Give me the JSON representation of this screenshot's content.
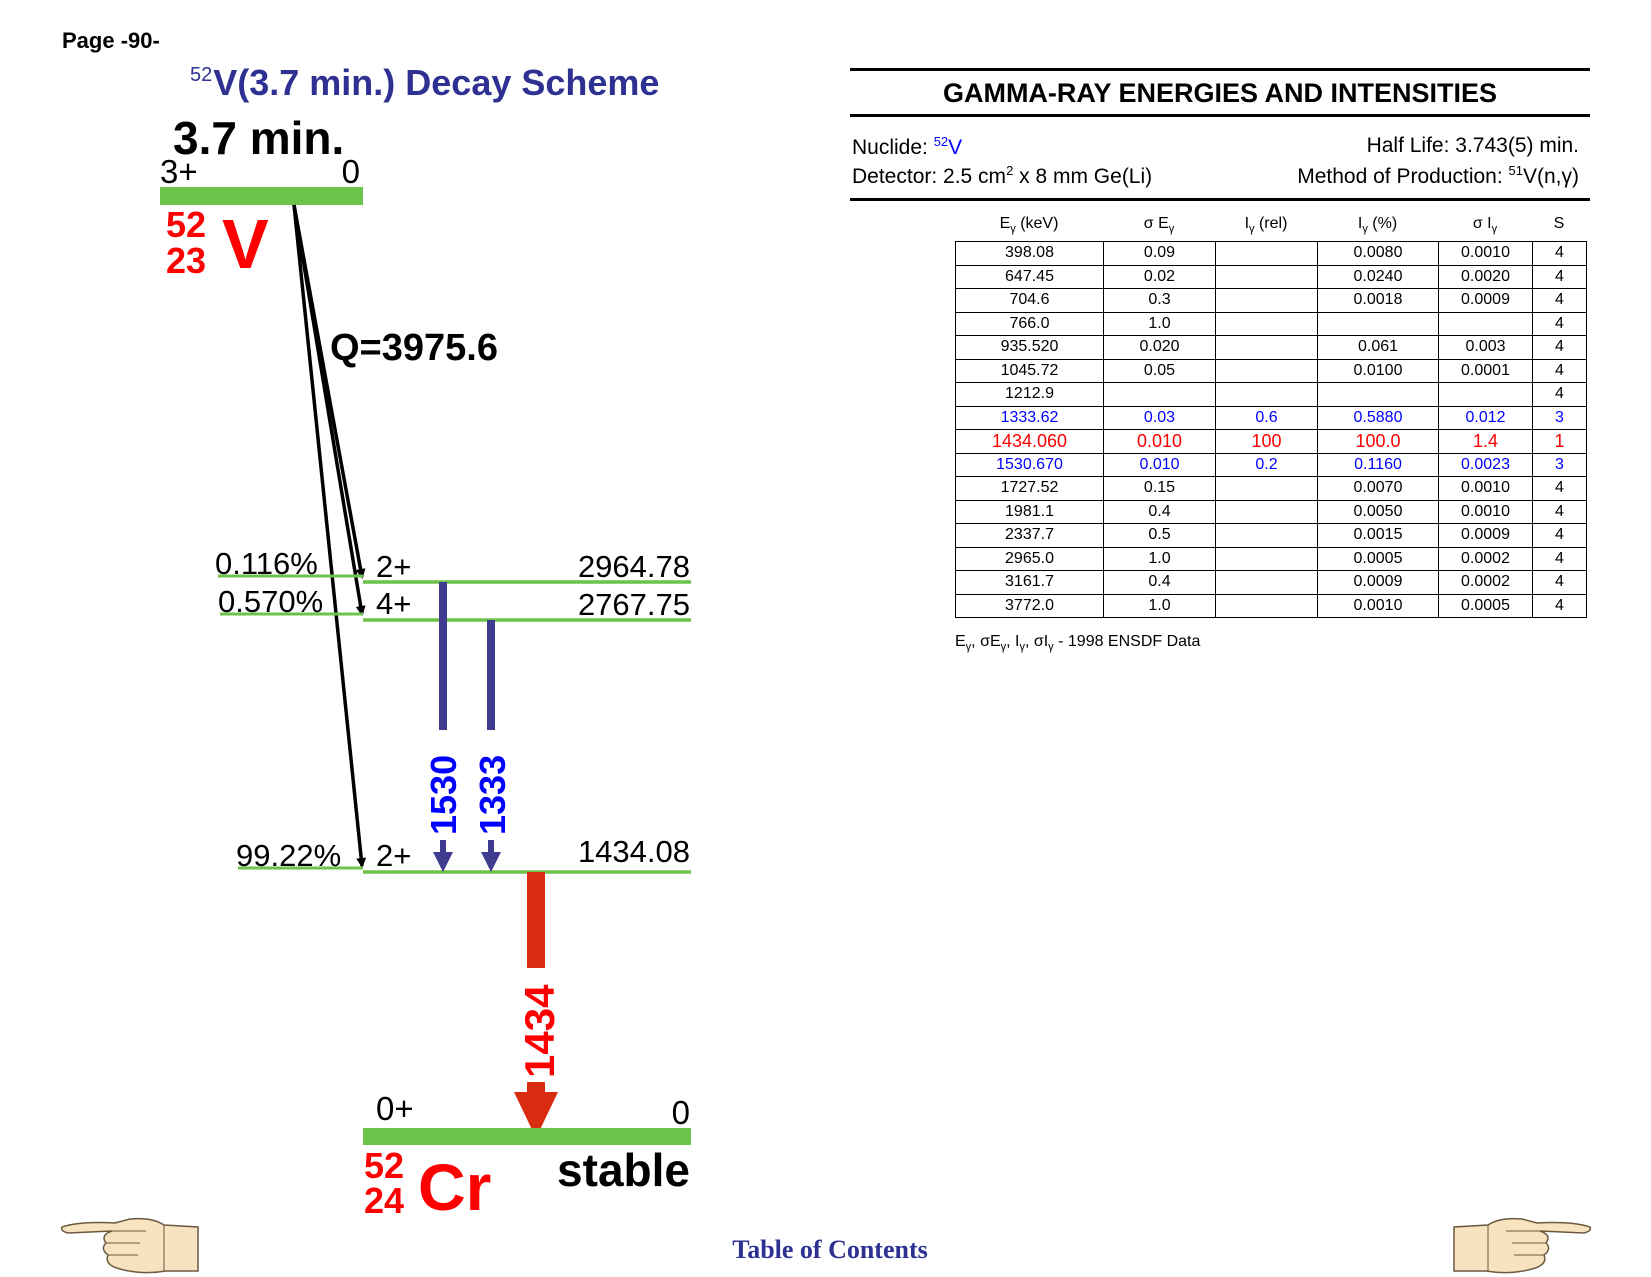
{
  "page": {
    "number": "Page -90-"
  },
  "scheme": {
    "title_mass": "52",
    "title": "V(3.7 min.) Decay Scheme",
    "parent": {
      "halflife": "3.7 min.",
      "spin": "3+",
      "energy": "0",
      "mass": "52",
      "z": "23",
      "symbol": "V"
    },
    "q_value": "Q=3975.6",
    "levels": [
      {
        "branch": "0.116%",
        "spin": "2+",
        "energy": "2964.78"
      },
      {
        "branch": "0.570%",
        "spin": "4+",
        "energy": "2767.75"
      },
      {
        "branch": "99.22%",
        "spin": "2+",
        "energy": "1434.08"
      }
    ],
    "gammas": {
      "g1530": "1530",
      "g1333": "1333",
      "g1434": "1434"
    },
    "daughter": {
      "spin": "0+",
      "energy": "0",
      "mass": "52",
      "z": "24",
      "symbol": "Cr",
      "status": "stable"
    },
    "colors": {
      "level": "#6cc24a",
      "weak_gamma": "#3f3b8f",
      "strong_gamma": "#d92b0f",
      "nuclide": "#ff0000",
      "title": "#2e3192"
    }
  },
  "gamma_panel": {
    "title": "GAMMA-RAY ENERGIES AND INTENSITIES",
    "nuclide_label": "Nuclide: ",
    "nuclide_mass": "52",
    "nuclide_symbol": "V",
    "half_life": "Half Life: 3.743(5) min.",
    "detector_prefix": "Detector: 2.5 cm",
    "detector_sup": "2",
    "detector_suffix": " x 8 mm Ge(Li)",
    "production_prefix": "Method of Production: ",
    "production_sup": "51",
    "production_suffix": "V(n,γ)",
    "headers": {
      "energy": "E",
      "energy_unit": " (keV)",
      "sigma_energy": "σ E",
      "rel": "I",
      "rel_unit": " (rel)",
      "pct": "I",
      "pct_unit": " (%)",
      "sigma_int": "σ I",
      "s": "S",
      "gamma_sub": "γ"
    },
    "rows": [
      [
        "398.08",
        "0.09",
        "",
        "0.0080",
        "0.0010",
        "4"
      ],
      [
        "647.45",
        "0.02",
        "",
        "0.0240",
        "0.0020",
        "4"
      ],
      [
        "704.6",
        "0.3",
        "",
        "0.0018",
        "0.0009",
        "4"
      ],
      [
        "766.0",
        "1.0",
        "",
        "",
        "",
        "4"
      ],
      [
        "935.520",
        "0.020",
        "",
        "0.061",
        "0.003",
        "4"
      ],
      [
        "1045.72",
        "0.05",
        "",
        "0.0100",
        "0.0001",
        "4"
      ],
      [
        "1212.9",
        "",
        "",
        "",
        "",
        "4"
      ],
      [
        "1333.62",
        "0.03",
        "0.6",
        "0.5880",
        "0.012",
        "3"
      ],
      [
        "1434.060",
        "0.010",
        "100",
        "100.0",
        "1.4",
        "1"
      ],
      [
        "1530.670",
        "0.010",
        "0.2",
        "0.1160",
        "0.0023",
        "3"
      ],
      [
        "1727.52",
        "0.15",
        "",
        "0.0070",
        "0.0010",
        "4"
      ],
      [
        "1981.1",
        "0.4",
        "",
        "0.0050",
        "0.0010",
        "4"
      ],
      [
        "2337.7",
        "0.5",
        "",
        "0.0015",
        "0.0009",
        "4"
      ],
      [
        "2965.0",
        "1.0",
        "",
        "0.0005",
        "0.0002",
        "4"
      ],
      [
        "3161.7",
        "0.4",
        "",
        "0.0009",
        "0.0002",
        "4"
      ],
      [
        "3772.0",
        "1.0",
        "",
        "0.0010",
        "0.0005",
        "4"
      ]
    ],
    "row_colors": [
      "",
      "",
      "",
      "",
      "",
      "",
      "",
      "blue",
      "red",
      "blue",
      "",
      "",
      "",
      "",
      "",
      ""
    ],
    "note": {
      "e": "E",
      "sep1": ", σE",
      "sep2": ", I",
      "sep3": ", σI",
      "tail": " - 1998 ENSDF Data",
      "sub": "γ"
    }
  },
  "footer": {
    "toc": "Table of Contents",
    "left_icon": "pointing-hand-left-icon",
    "right_icon": "pointing-hand-right-icon"
  }
}
